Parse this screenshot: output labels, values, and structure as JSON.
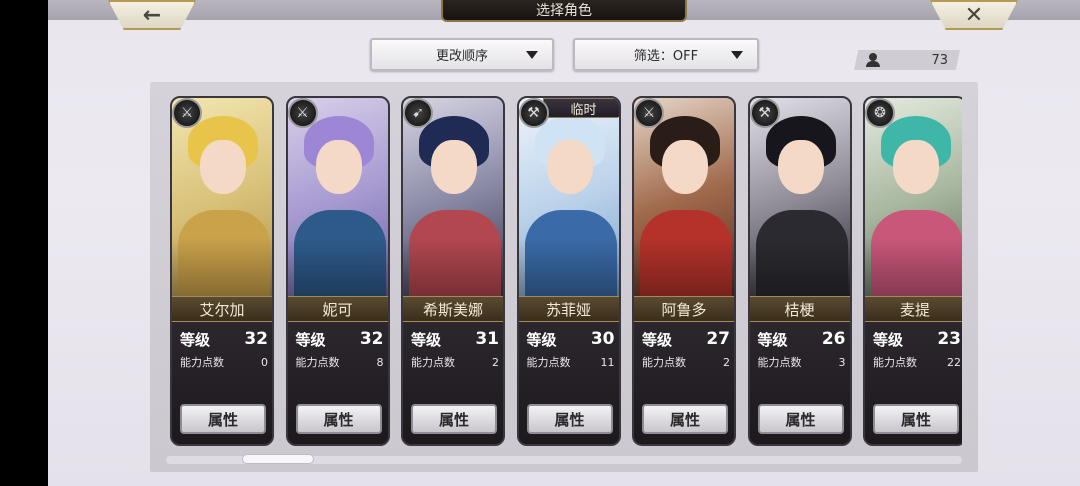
{
  "header": {
    "title": "选择角色",
    "back_icon": "←",
    "close_icon": "✕"
  },
  "filters": {
    "sort_label": "更改顺序",
    "filter_label": "筛选：OFF"
  },
  "roster_count": "73",
  "colors": {
    "gold_border": "#b59a56",
    "name_bar": "#4a3c26",
    "panel_bg": "#d0cdd4"
  },
  "characters": [
    {
      "name": "艾尔加",
      "level_label": "等级",
      "level": "32",
      "points_label": "能力点数",
      "points": "0",
      "attr_label": "属性",
      "type_icon": "⚔",
      "temp": ""
    },
    {
      "name": "妮可",
      "level_label": "等级",
      "level": "32",
      "points_label": "能力点数",
      "points": "8",
      "attr_label": "属性",
      "type_icon": "⚔",
      "temp": ""
    },
    {
      "name": "希斯美娜",
      "level_label": "等级",
      "level": "31",
      "points_label": "能力点数",
      "points": "2",
      "attr_label": "属性",
      "type_icon": "➹",
      "temp": ""
    },
    {
      "name": "苏菲娅",
      "level_label": "等级",
      "level": "30",
      "points_label": "能力点数",
      "points": "11",
      "attr_label": "属性",
      "type_icon": "⚒",
      "temp": "临时"
    },
    {
      "name": "阿鲁多",
      "level_label": "等级",
      "level": "27",
      "points_label": "能力点数",
      "points": "2",
      "attr_label": "属性",
      "type_icon": "⚔",
      "temp": ""
    },
    {
      "name": "桔梗",
      "level_label": "等级",
      "level": "26",
      "points_label": "能力点数",
      "points": "3",
      "attr_label": "属性",
      "type_icon": "⚒",
      "temp": ""
    },
    {
      "name": "麦提",
      "level_label": "等级",
      "level": "23",
      "points_label": "能力点数",
      "points": "22",
      "attr_label": "属性",
      "type_icon": "❂",
      "temp": ""
    }
  ]
}
